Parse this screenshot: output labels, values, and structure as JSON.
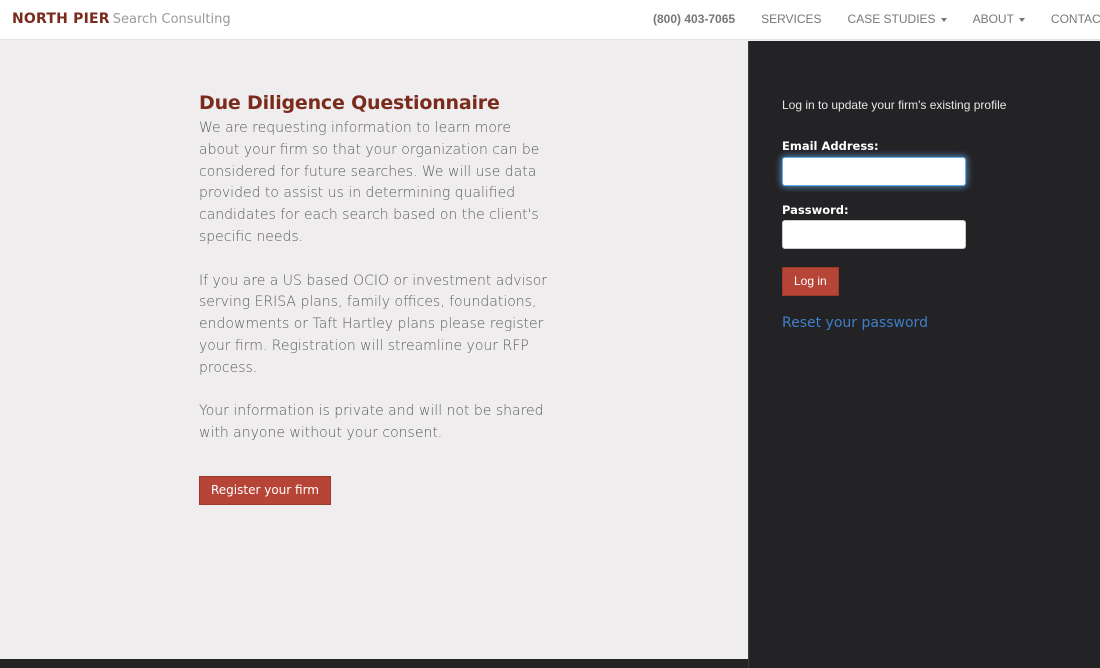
{
  "header": {
    "brand_strong": "NORTH PIER",
    "brand_light": "Search Consulting",
    "phone": "(800) 403-7065",
    "nav": [
      {
        "label": "SERVICES",
        "dropdown": false
      },
      {
        "label": "CASE STUDIES",
        "dropdown": true
      },
      {
        "label": "ABOUT",
        "dropdown": true
      },
      {
        "label": "CONTACT",
        "dropdown": false
      }
    ]
  },
  "main": {
    "title": "Due Diligence Questionnaire",
    "paragraphs": [
      "We are requesting information to learn more about your firm so that your organization can be considered for future searches. We will use data provided to assist us in determining qualified candidates for each search based on the client's specific needs.",
      "If you are a US based OCIO or investment advisor serving ERISA plans, family offices, foundations, endowments or Taft Hartley plans please register your firm. Registration will streamline your RFP process.",
      "Your information is private and will not be shared with anyone without your consent."
    ],
    "register_label": "Register your firm"
  },
  "login": {
    "intro": "Log in to update your firm's existing profile",
    "email_label": "Email Address:",
    "email_value": "",
    "password_label": "Password:",
    "password_value": "",
    "submit_label": "Log in",
    "reset_label": "Reset your password"
  },
  "colors": {
    "brand": "#7b2b1c",
    "button": "#b74537",
    "link": "#3e7fc8",
    "panel": "#232225",
    "page": "#efedee"
  }
}
